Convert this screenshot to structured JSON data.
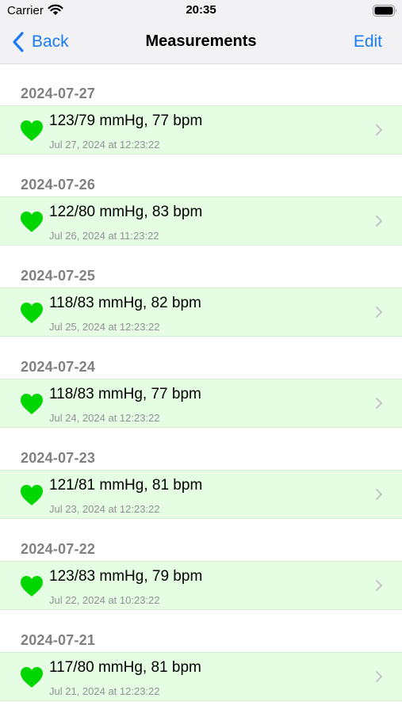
{
  "status_bar": {
    "carrier": "Carrier",
    "time": "20:35"
  },
  "nav": {
    "back_label": "Back",
    "title": "Measurements",
    "edit_label": "Edit"
  },
  "colors": {
    "accent": "#1a7cf5",
    "heart": "#00d600",
    "row_background": "#e5fde3"
  },
  "sections": [
    {
      "header": "2024-07-27",
      "title": "123/79 mmHg, 77 bpm",
      "subtitle": "Jul 27, 2024 at 12:23:22"
    },
    {
      "header": "2024-07-26",
      "title": "122/80 mmHg, 83 bpm",
      "subtitle": "Jul 26, 2024 at 11:23:22"
    },
    {
      "header": "2024-07-25",
      "title": "118/83 mmHg, 82 bpm",
      "subtitle": "Jul 25, 2024 at 12:23:22"
    },
    {
      "header": "2024-07-24",
      "title": "118/83 mmHg, 77 bpm",
      "subtitle": "Jul 24, 2024 at 12:23:22"
    },
    {
      "header": "2024-07-23",
      "title": "121/81 mmHg, 81 bpm",
      "subtitle": "Jul 23, 2024 at 12:23:22"
    },
    {
      "header": "2024-07-22",
      "title": "123/83 mmHg, 79 bpm",
      "subtitle": "Jul 22, 2024 at 10:23:22"
    },
    {
      "header": "2024-07-21",
      "title": "117/80 mmHg, 81 bpm",
      "subtitle": "Jul 21, 2024 at 12:23:22"
    }
  ]
}
